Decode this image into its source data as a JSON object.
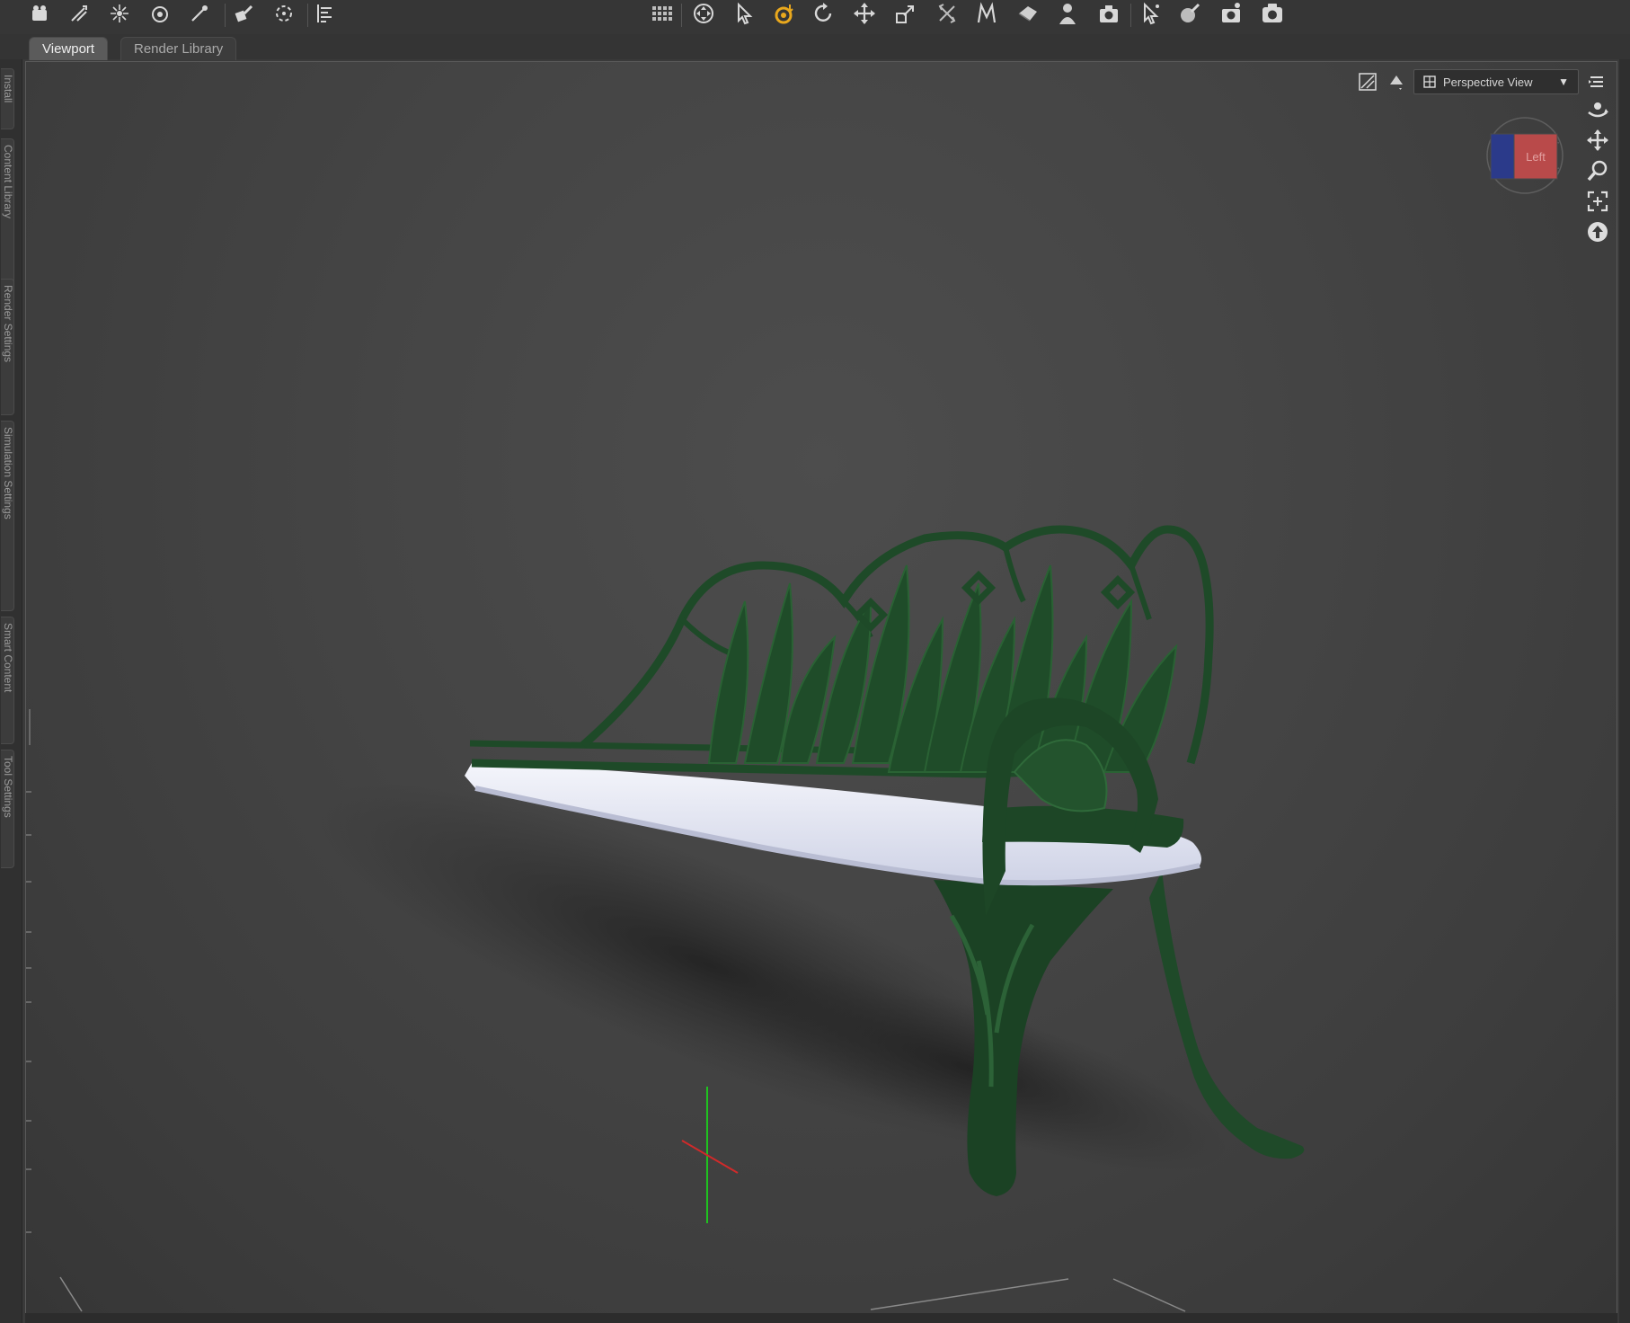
{
  "toolbar": {
    "left_tools": [
      "figure-pose-icon",
      "spotlight-add-icon",
      "point-light-icon",
      "distant-light-icon",
      "linear-light-icon",
      "node-weight-icon",
      "joint-editor-icon",
      "align-icon"
    ],
    "center_tools": [
      "grid-icon",
      "universal-tool-icon",
      "select-arrow-icon",
      "active-pose-icon",
      "rotate-tool-icon",
      "translate-tool-icon",
      "scale-tool-icon",
      "transform-icon",
      "morph-icon",
      "geometry-editor-icon",
      "figure-tool-icon",
      "camera-settings-icon",
      "pointer-node-icon",
      "surface-tool-icon",
      "render-camera-icon",
      "render-icon"
    ]
  },
  "tabs": [
    {
      "label": "Viewport",
      "active": true
    },
    {
      "label": "Render Library",
      "active": false
    }
  ],
  "side_tabs": [
    "Install",
    "Content Library",
    "Render Settings",
    "Simulation Settings",
    "Smart Content",
    "Tool Settings"
  ],
  "viewport": {
    "camera_label": "Perspective View",
    "nav_cube_face": "Left"
  },
  "colors": {
    "accent": "#e9a81d",
    "bench_iron": "#1f4a29",
    "bench_seat": "#eceef6",
    "axis_y": "#1fc31f",
    "axis_x": "#d02a2a"
  }
}
